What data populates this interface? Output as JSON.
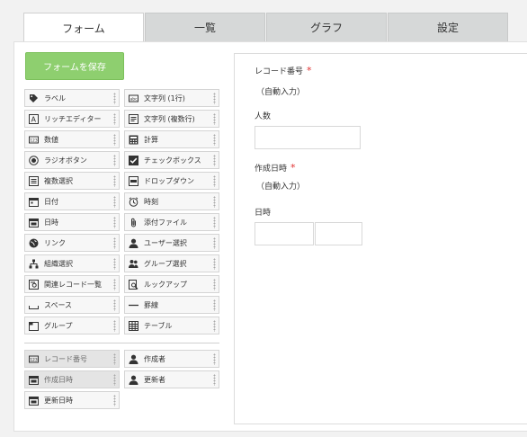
{
  "tabs": [
    "フォーム",
    "一覧",
    "グラフ",
    "設定"
  ],
  "save_button": "フォームを保存",
  "palette": {
    "fields": [
      {
        "label": "ラベル",
        "icon": "tag-icon"
      },
      {
        "label": "文字列 (1行)",
        "icon": "text-single-icon"
      },
      {
        "label": "リッチエディター",
        "icon": "rich-editor-icon"
      },
      {
        "label": "文字列 (複数行)",
        "icon": "text-multi-icon"
      },
      {
        "label": "数値",
        "icon": "number-icon"
      },
      {
        "label": "計算",
        "icon": "calculator-icon"
      },
      {
        "label": "ラジオボタン",
        "icon": "radio-icon"
      },
      {
        "label": "チェックボックス",
        "icon": "checkbox-icon"
      },
      {
        "label": "複数選択",
        "icon": "multi-select-icon"
      },
      {
        "label": "ドロップダウン",
        "icon": "dropdown-icon"
      },
      {
        "label": "日付",
        "icon": "calendar-icon"
      },
      {
        "label": "時刻",
        "icon": "clock-icon"
      },
      {
        "label": "日時",
        "icon": "datetime-icon"
      },
      {
        "label": "添付ファイル",
        "icon": "paperclip-icon"
      },
      {
        "label": "リンク",
        "icon": "globe-icon"
      },
      {
        "label": "ユーザー選択",
        "icon": "user-icon"
      },
      {
        "label": "組織選択",
        "icon": "org-icon"
      },
      {
        "label": "グループ選択",
        "icon": "group-icon"
      },
      {
        "label": "関連レコード一覧",
        "icon": "related-records-icon"
      },
      {
        "label": "ルックアップ",
        "icon": "lookup-icon"
      },
      {
        "label": "スペース",
        "icon": "space-icon"
      },
      {
        "label": "罫線",
        "icon": "line-icon"
      },
      {
        "label": "グループ",
        "icon": "group-folder-icon"
      },
      {
        "label": "テーブル",
        "icon": "table-icon"
      }
    ],
    "system_fields": [
      {
        "label": "レコード番号",
        "icon": "number-icon"
      },
      {
        "label": "作成者",
        "icon": "user-icon"
      },
      {
        "label": "作成日時",
        "icon": "datetime-icon"
      },
      {
        "label": "更新者",
        "icon": "user-icon"
      },
      {
        "label": "更新日時",
        "icon": "datetime-icon"
      }
    ]
  },
  "form": {
    "record_number_label": "レコード番号",
    "required_mark": "*",
    "record_number_value": "（自動入力）",
    "people_label": "人数",
    "created_label": "作成日時",
    "created_value": "（自動入力）",
    "datetime_label": "日時"
  }
}
